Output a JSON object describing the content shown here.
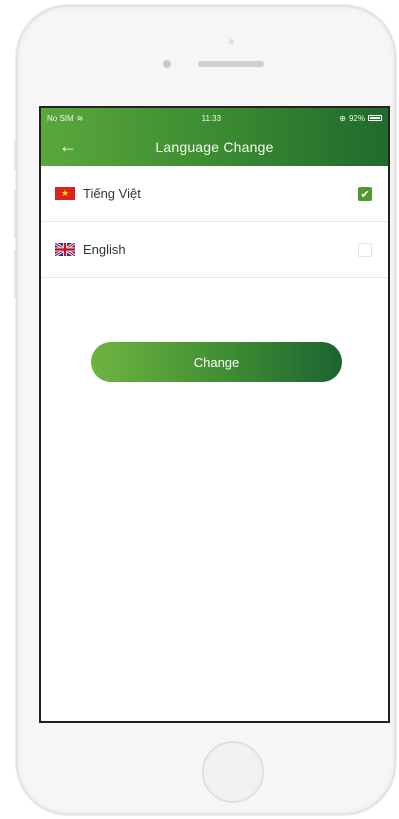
{
  "status_bar": {
    "carrier": "No SIM",
    "time": "11:33",
    "battery": "92%"
  },
  "header": {
    "title": "Language Change",
    "back_icon": "arrow-left-icon"
  },
  "languages": [
    {
      "label": "Tiếng Việt",
      "flag": "vietnam-flag-icon",
      "selected": true
    },
    {
      "label": "English",
      "flag": "uk-flag-icon",
      "selected": false
    }
  ],
  "actions": {
    "change_label": "Change"
  },
  "colors": {
    "accent": "#4f9a34",
    "header_start": "#5aa83c",
    "header_end": "#1f6b2c"
  }
}
